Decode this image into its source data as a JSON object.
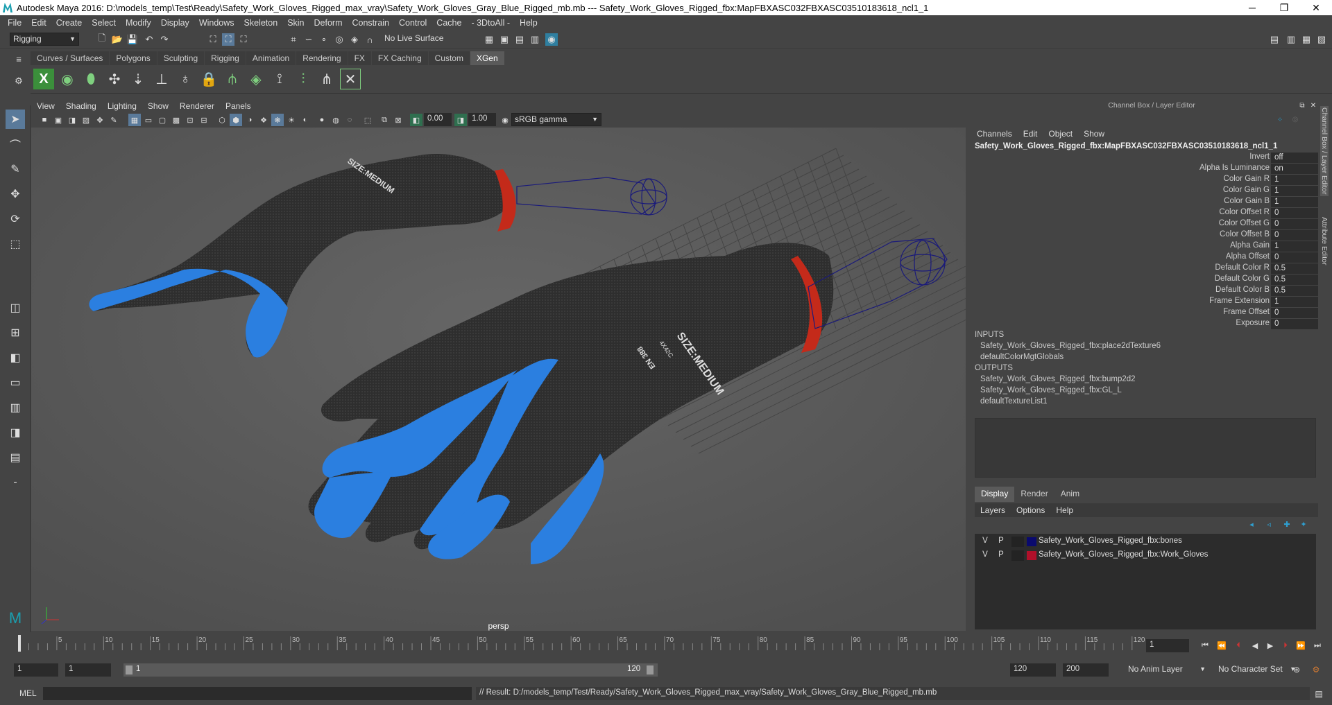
{
  "window": {
    "title": "Autodesk Maya 2016: D:\\models_temp\\Test\\Ready\\Safety_Work_Gloves_Rigged_max_vray\\Safety_Work_Gloves_Gray_Blue_Rigged_mb.mb  ---  Safety_Work_Gloves_Rigged_fbx:MapFBXASC032FBXASC03510183618_ncl1_1",
    "min": "─",
    "max": "❐",
    "close": "✕"
  },
  "menu": [
    "File",
    "Edit",
    "Create",
    "Select",
    "Modify",
    "Display",
    "Windows",
    "Skeleton",
    "Skin",
    "Deform",
    "Constrain",
    "Control",
    "Cache",
    "- 3DtoAll -",
    "Help"
  ],
  "toolbar": {
    "mode": "Rigging",
    "live_surface": "No Live Surface"
  },
  "shelf_tabs": [
    "Curves / Surfaces",
    "Polygons",
    "Sculpting",
    "Rigging",
    "Animation",
    "Rendering",
    "FX",
    "FX Caching",
    "Custom",
    "XGen"
  ],
  "active_shelf": "XGen",
  "viewport": {
    "menu": [
      "View",
      "Shading",
      "Lighting",
      "Show",
      "Renderer",
      "Panels"
    ],
    "exposure": "0.00",
    "gamma": "1.00",
    "colorspace": "sRGB gamma",
    "camera": "persp",
    "glove_label_1": "SIZE:MEDIUM",
    "glove_label_2": "EN 388",
    "glove_label_3": "4X42C",
    "glove_color": "#2b7fe0",
    "glove_body_color": "#2e2e2e",
    "cuff_color": "#c42a1a"
  },
  "channel_box": {
    "title": "Channel Box / Layer Editor",
    "menu": [
      "Channels",
      "Edit",
      "Object",
      "Show"
    ],
    "node": "Safety_Work_Gloves_Rigged_fbx:MapFBXASC032FBXASC03510183618_ncl1_1",
    "attributes": [
      {
        "name": "Invert",
        "value": "off"
      },
      {
        "name": "Alpha Is Luminance",
        "value": "on"
      },
      {
        "name": "Color Gain R",
        "value": "1"
      },
      {
        "name": "Color Gain G",
        "value": "1"
      },
      {
        "name": "Color Gain B",
        "value": "1"
      },
      {
        "name": "Color Offset R",
        "value": "0"
      },
      {
        "name": "Color Offset G",
        "value": "0"
      },
      {
        "name": "Color Offset B",
        "value": "0"
      },
      {
        "name": "Alpha Gain",
        "value": "1"
      },
      {
        "name": "Alpha Offset",
        "value": "0"
      },
      {
        "name": "Default Color R",
        "value": "0.5"
      },
      {
        "name": "Default Color G",
        "value": "0.5"
      },
      {
        "name": "Default Color B",
        "value": "0.5"
      },
      {
        "name": "Frame Extension",
        "value": "1"
      },
      {
        "name": "Frame Offset",
        "value": "0"
      },
      {
        "name": "Exposure",
        "value": "0"
      }
    ],
    "inputs_label": "INPUTS",
    "inputs": [
      "Safety_Work_Gloves_Rigged_fbx:place2dTexture6",
      "defaultColorMgtGlobals"
    ],
    "outputs_label": "OUTPUTS",
    "outputs": [
      "Safety_Work_Gloves_Rigged_fbx:bump2d2",
      "Safety_Work_Gloves_Rigged_fbx:GL_L",
      "defaultTextureList1"
    ]
  },
  "layer_editor": {
    "tabs": [
      "Display",
      "Render",
      "Anim"
    ],
    "active_tab": "Display",
    "menu": [
      "Layers",
      "Options",
      "Help"
    ],
    "layers": [
      {
        "v": "V",
        "p": "P",
        "name": "Safety_Work_Gloves_Rigged_fbx:bones",
        "color": "#0a0a6e"
      },
      {
        "v": "V",
        "p": "P",
        "name": "Safety_Work_Gloves_Rigged_fbx:Work_Gloves",
        "color": "#b0102a"
      }
    ]
  },
  "side_tabs": [
    "Channel Box / Layer Editor",
    "Attribute Editor"
  ],
  "timeline": {
    "ticks": [
      "5",
      "10",
      "15",
      "20",
      "25",
      "30",
      "35",
      "40",
      "45",
      "50",
      "55",
      "60",
      "65",
      "70",
      "75",
      "80",
      "85",
      "90",
      "95",
      "100",
      "105",
      "110",
      "115",
      "120"
    ],
    "current_frame": "1"
  },
  "range": {
    "start": "1",
    "anim_start": "1",
    "slider_start": "1",
    "slider_end": "120",
    "end": "120",
    "anim_end": "200",
    "anim_layer": "No Anim Layer",
    "char_set": "No Character Set"
  },
  "command": {
    "lang": "MEL",
    "result": "// Result: D:/models_temp/Test/Ready/Safety_Work_Gloves_Rigged_max_vray/Safety_Work_Gloves_Gray_Blue_Rigged_mb.mb"
  }
}
